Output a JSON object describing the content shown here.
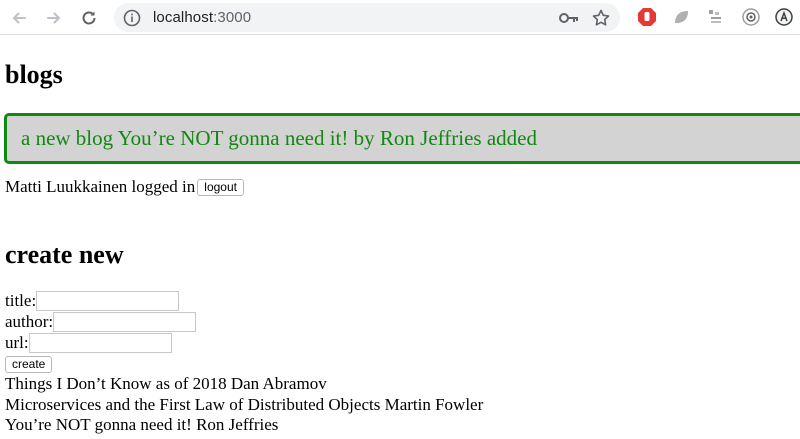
{
  "browser": {
    "url_host": "localhost",
    "url_port": ":3000"
  },
  "page": {
    "title": "blogs",
    "notification": "a new blog You’re NOT gonna need it! by Ron Jeffries added",
    "logged_in_text": "Matti Luukkainen logged in",
    "logout_label": "logout",
    "create_heading": "create new",
    "form": {
      "title_label": "title:",
      "author_label": "author:",
      "url_label": "url:",
      "title_value": "",
      "author_value": "",
      "url_value": "",
      "create_label": "create"
    },
    "blogs": [
      "Things I Don’t Know as of 2018 Dan Abramov",
      "Microservices and the First Law of Distributed Objects Martin Fowler",
      "You’re NOT gonna need it! Ron Jeffries"
    ]
  },
  "colors": {
    "notification_text": "#118811",
    "notification_bg": "#d3d3d3"
  }
}
